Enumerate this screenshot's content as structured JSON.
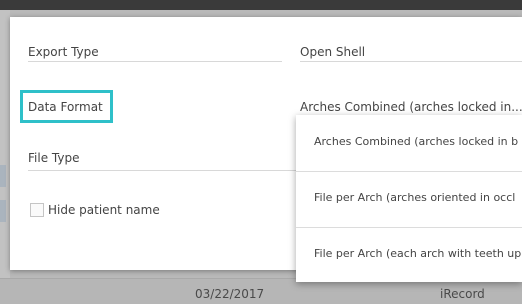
{
  "background": {
    "date": "03/22/2017",
    "source": "iRecord"
  },
  "dialog": {
    "export_type_label": "Export Type",
    "export_type_value": "Open Shell",
    "data_format_label": "Data Format",
    "data_format_value": "Arches Combined (arches locked in...",
    "file_type_label": "File Type",
    "hide_patient_label": "Hide patient name",
    "hide_patient_checked": false
  },
  "dropdown": {
    "options": [
      "Arches Combined (arches locked in b",
      "File per Arch (arches oriented in occl",
      "File per Arch (each arch with teeth up"
    ]
  },
  "colors": {
    "highlight": "#2ec0c9",
    "overlay": "#b9b9b9"
  }
}
